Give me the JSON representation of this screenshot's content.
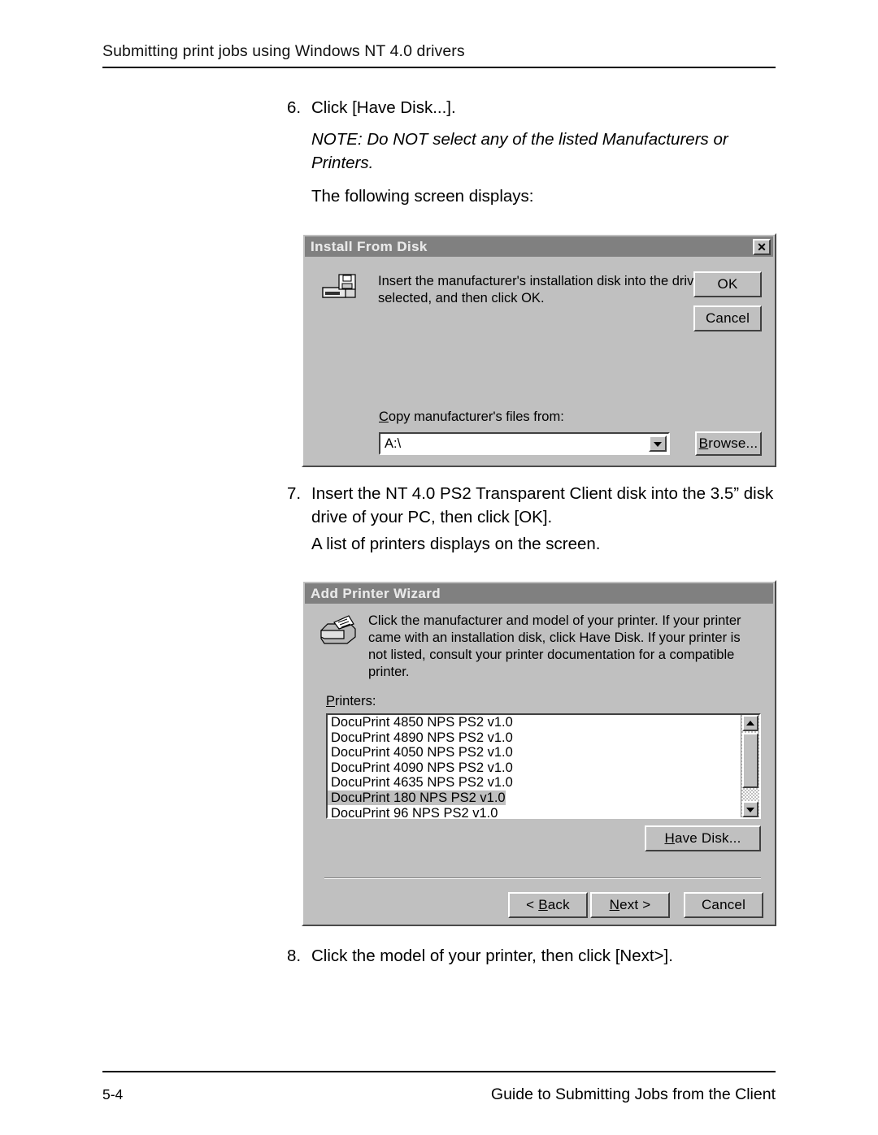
{
  "page": {
    "header_title": "Submitting print jobs using Windows NT 4.0 drivers",
    "footer_page_number": "5-4",
    "footer_title": "Guide to Submitting Jobs from the Client"
  },
  "steps": {
    "step6": {
      "number": "6.",
      "text": "Click [Have Disk...].",
      "note": "NOTE:  Do NOT select any of the listed Manufacturers or Printers.",
      "follow_up": "The following screen displays:"
    },
    "step7": {
      "number": "7.",
      "text": "Insert the NT 4.0 PS2 Transparent Client disk into the 3.5” disk drive of your PC, then click [OK].",
      "follow_up": "A list of printers displays on the screen."
    },
    "step8": {
      "number": "8.",
      "text": "Click the model of your printer, then click [Next>]."
    }
  },
  "install_from_disk_dialog": {
    "title": "Install From Disk",
    "close_label": "✕",
    "message": "Insert the manufacturer's installation disk into the drive selected, and then click OK.",
    "ok_label": "OK",
    "cancel_label": "Cancel",
    "copy_from_label": "Copy manufacturer's files from:",
    "copy_from_label_accel": "C",
    "copy_from_value": "A:\\",
    "dropdown_arrow": "▼",
    "browse_label": "Browse...",
    "browse_accel": "B",
    "icon": "floppy-drive-icon"
  },
  "add_printer_wizard_dialog": {
    "title": "Add Printer Wizard",
    "message": "Click the manufacturer and model of your printer.  If your printer came with an installation disk, click Have Disk.  If your printer is not listed, consult your printer documentation for a compatible printer.",
    "printers_label": "Printers:",
    "printers_label_accel": "P",
    "printers": [
      {
        "name": "DocuPrint 4850 NPS PS2 v1.0",
        "selected": false
      },
      {
        "name": "DocuPrint 4890 NPS PS2 v1.0",
        "selected": false
      },
      {
        "name": "DocuPrint 4050 NPS PS2 v1.0",
        "selected": false
      },
      {
        "name": "DocuPrint 4090 NPS PS2 v1.0",
        "selected": false
      },
      {
        "name": "DocuPrint 4635 NPS PS2 v1.0",
        "selected": false
      },
      {
        "name": "DocuPrint 180 NPS PS2 v1.0",
        "selected": true
      },
      {
        "name": "DocuPrint 96 NPS PS2 v1.0",
        "selected": false
      }
    ],
    "have_disk_label": "Have Disk...",
    "have_disk_accel": "H",
    "back_label": "< Back",
    "back_accel": "B",
    "next_label": "Next >",
    "next_accel": "N",
    "cancel_label": "Cancel",
    "scroll_up_arrow": "▲",
    "scroll_down_arrow": "▼",
    "icon": "printer-icon"
  },
  "colors": {
    "dialog_face": "#c0c0c0",
    "titlebar": "#808080",
    "titlebar_text": "#e8e8e8",
    "selection": "#c0c0c0",
    "page_background": "#ffffff",
    "text": "#000000"
  }
}
